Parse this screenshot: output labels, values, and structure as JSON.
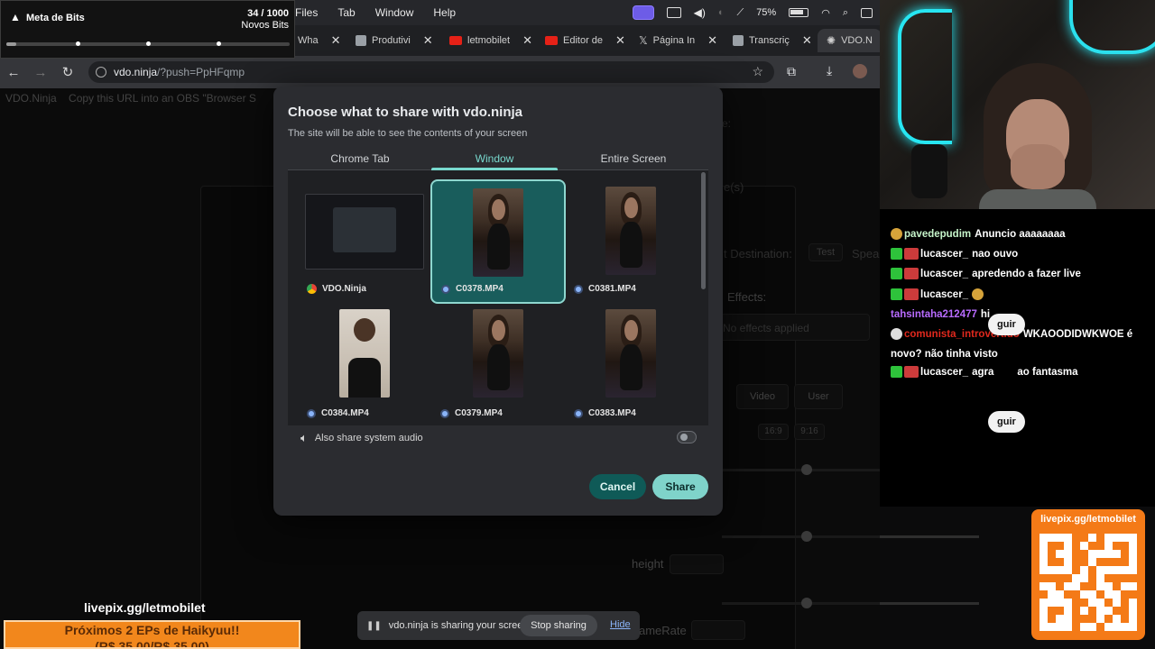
{
  "menubar": {
    "items": [
      "Files",
      "Tab",
      "Window",
      "Help"
    ],
    "battery": "75%"
  },
  "alert_widget": {
    "title": "Meta de Bits",
    "count": "34 / 1000",
    "subtitle": "Novos Bits",
    "progress_fraction": 0.034
  },
  "tabs": [
    {
      "label": "Wha",
      "color": "#5aa0e6"
    },
    {
      "label": "Produtivi",
      "color": "#9aa0a6"
    },
    {
      "label": "letmobilet",
      "color": "#e62117"
    },
    {
      "label": "Editor de",
      "color": "#e62117"
    },
    {
      "label": "Página In",
      "color": "#dddddd"
    },
    {
      "label": "Transcriç",
      "color": "#9aa0a6"
    },
    {
      "label": "VDO.N",
      "color": "#dddddd"
    }
  ],
  "address": {
    "host": "vdo.ninja",
    "path": "/?push=PpHFqmp"
  },
  "page": {
    "header_brand": "VDO.Ninja",
    "header_text": "Copy this URL into an OBS \"Browser S",
    "bg_labels": {
      "destination": "t Destination:",
      "test": "Test",
      "speaker": "Speake",
      "effects": "Effects:",
      "no_effects": "No effects applied",
      "video": "Video",
      "user": "User",
      "ratio1": "16:9",
      "ratio2": "9:16",
      "height": "height",
      "framerate": "ameRate",
      "devices": "e(s)"
    }
  },
  "dialog": {
    "title": "Choose what to share with vdo.ninja",
    "subtitle": "The site will be able to see the contents of your screen",
    "tabs": [
      "Chrome Tab",
      "Window",
      "Entire Screen"
    ],
    "selected_tab": "Window",
    "windows": [
      {
        "label": "VDO.Ninja",
        "kind": "chrome"
      },
      {
        "label": "C0378.MP4",
        "kind": "video",
        "selected": true
      },
      {
        "label": "C0381.MP4",
        "kind": "video"
      },
      {
        "label": "C0384.MP4",
        "kind": "video"
      },
      {
        "label": "C0379.MP4",
        "kind": "video"
      },
      {
        "label": "C0383.MP4",
        "kind": "video"
      }
    ],
    "audio_label": "Also share system audio",
    "cancel_label": "Cancel",
    "share_label": "Share"
  },
  "sharing_bar": {
    "text": "vdo.ninja is sharing your screen.",
    "stop_label": "Stop sharing",
    "hide_label": "Hide"
  },
  "chat": {
    "messages": [
      {
        "user": "pavedepudim",
        "text": "Anuncio aaaaaaaa",
        "user_color": "#c5f3c9"
      },
      {
        "user": "lucascer_",
        "text": "nao ouvo",
        "user_color": "#ffffff"
      },
      {
        "user": "lucascer_",
        "text": "apredendo a fazer live",
        "user_color": "#ffffff"
      },
      {
        "user": "lucascer_",
        "text": "",
        "user_color": "#ffffff"
      },
      {
        "user": "tahsintaha212477",
        "text": "hi",
        "user_color": "#b86bff"
      },
      {
        "user": "comunista_introvertido",
        "text": "WKAOODIDWKWOE é novo? não tinha visto",
        "user_color": "#e0281d"
      },
      {
        "user": "lucascer_",
        "text": "agra",
        "tail": "ao fantasma",
        "user_color": "#ffffff"
      }
    ],
    "follow_pill": "guir"
  },
  "livepix": {
    "qr_label": "livepix.gg/letmobilet",
    "bottom_label": "livepix.gg/letmobilet",
    "banner_line1": "Próximos 2 EPs de Haikyuu!!",
    "banner_line2": "(R$ 35,00/R$ 35,00)"
  },
  "colors": {
    "accent": "#78d9ce",
    "share_button": "#7fd3ca",
    "cancel_button": "#0f5a57",
    "selected_tile": "#195d5c",
    "livepix_orange": "#f47a17"
  }
}
